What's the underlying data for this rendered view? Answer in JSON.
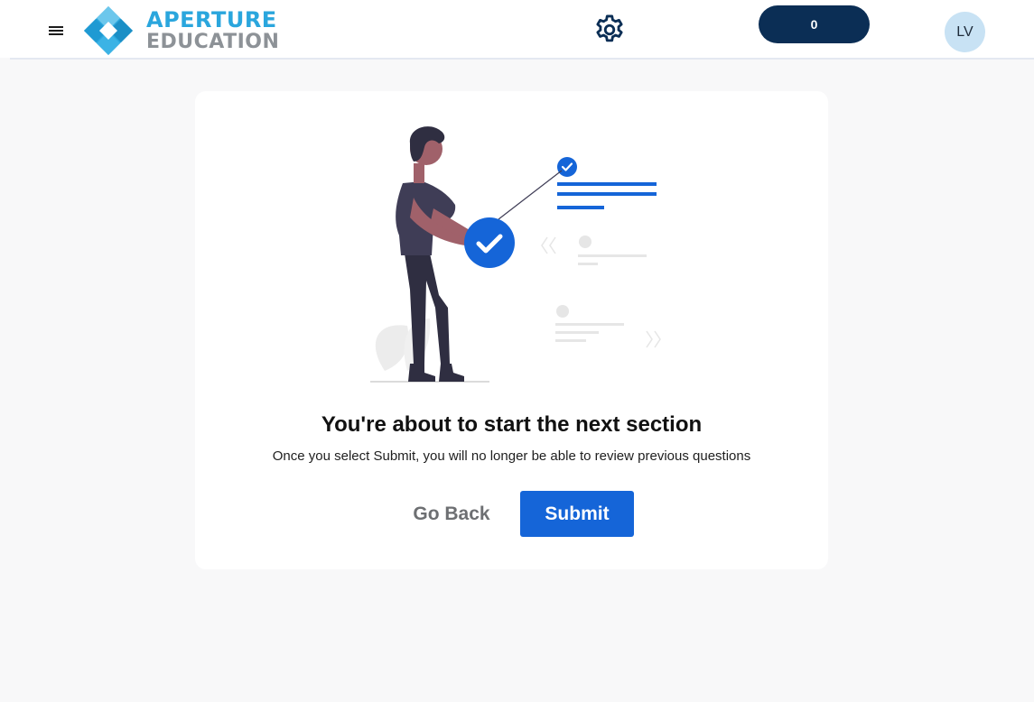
{
  "header": {
    "logo_line1": "APERTURE",
    "logo_line2": "EDUCATION",
    "score": "0",
    "avatar_initials": "LV"
  },
  "dialog": {
    "title": "You're about to start the next section",
    "message": "Once you select Submit, you will no longer be able to review previous questions",
    "go_back_label": "Go Back",
    "submit_label": "Submit"
  },
  "colors": {
    "accent": "#1565d8",
    "brand_blue": "#2aa6dd",
    "brand_gray": "#8d9297",
    "score_pill": "#0b2e55",
    "avatar_bg": "#c8e2f4"
  },
  "icons": {
    "menu": "hamburger-menu-icon",
    "settings": "gear-icon",
    "logo": "aperture-diamond-logo-icon"
  }
}
